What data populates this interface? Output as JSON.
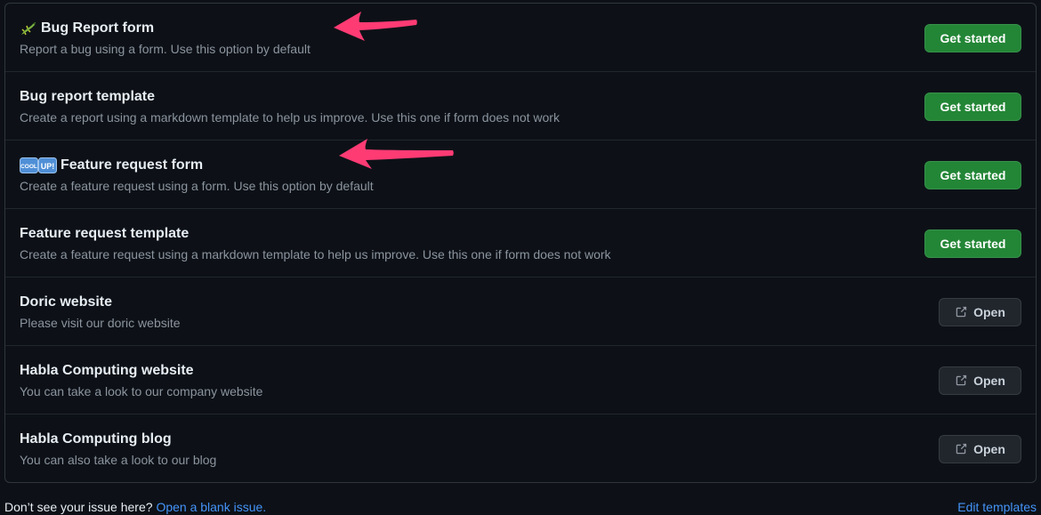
{
  "templates": [
    {
      "emoji": "lizard-emoji-icon",
      "title": "Bug Report form",
      "description": "Report a bug using a form. Use this option by default",
      "action": "Get started"
    },
    {
      "title": "Bug report template",
      "description": "Create a report using a markdown template to help us improve. Use this one if form does not work",
      "action": "Get started"
    },
    {
      "emoji": "cool-up-emoji-icon",
      "title": "Feature request form",
      "description": "Create a feature request using a form. Use this option by default",
      "action": "Get started"
    },
    {
      "title": "Feature request template",
      "description": "Create a feature request using a markdown template to help us improve. Use this one if form does not work",
      "action": "Get started"
    }
  ],
  "links": [
    {
      "title": "Doric website",
      "description": "Please visit our doric website",
      "action": "Open"
    },
    {
      "title": "Habla Computing website",
      "description": "You can take a look to our company website",
      "action": "Open"
    },
    {
      "title": "Habla Computing blog",
      "description": "You can also take a look to our blog",
      "action": "Open"
    }
  ],
  "footer": {
    "prompt": "Don’t see your issue here?",
    "blank_issue_link": "Open a blank issue.",
    "edit_templates_link": "Edit templates"
  },
  "colors": {
    "background": "#0d1117",
    "primary_button": "#238636",
    "link": "#4493f8",
    "annotation_arrow": "#ff3b74"
  }
}
